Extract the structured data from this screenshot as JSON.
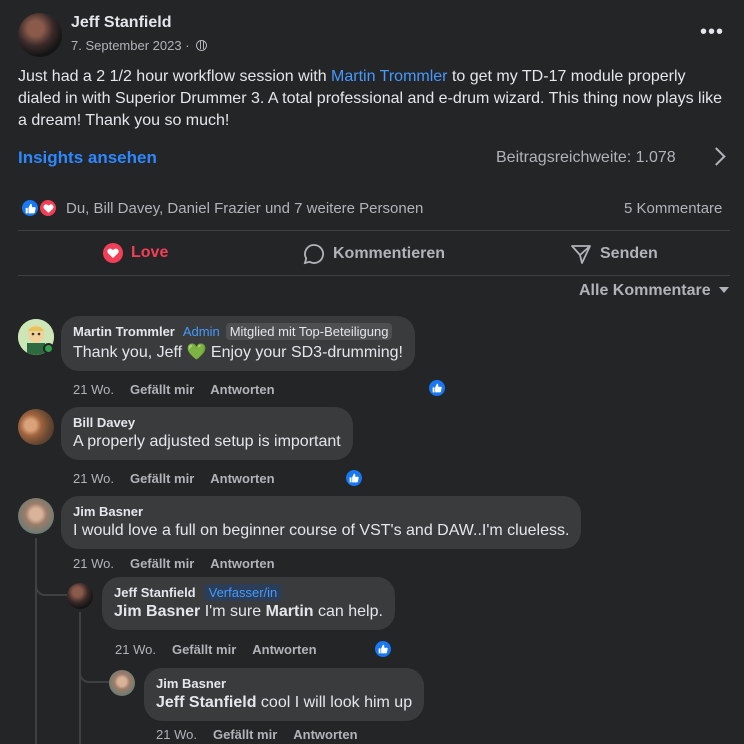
{
  "post": {
    "author": "Jeff Stanfield",
    "date": "7. September 2023 ·",
    "more_label": "•••",
    "text_before": "Just had a 2 1/2 hour workflow session with ",
    "mention": "Martin Trommler",
    "text_after": " to get my TD-17 module properly dialed in with Superior Drummer 3. A total professional and e-drum wizard. This thing now plays like a dream! Thank you so much!",
    "insights_label": "Insights ansehen",
    "reach_label": "Beitragsreichweite: 1.078",
    "reactors": "Du, Bill Davey, Daniel Frazier und 7 weitere Personen",
    "comment_count": "5 Kommentare"
  },
  "actions": {
    "love": "Love",
    "comment": "Kommentieren",
    "send": "Senden"
  },
  "sort_label": "Alle Kommentare",
  "comments": [
    {
      "name": "Martin Trommler",
      "badge1": "Admin",
      "badge2": "Mitglied mit Top-Beteiligung",
      "text": "Thank you, Jeff 💚 Enjoy your SD3-drumming!",
      "time": "21 Wo.",
      "like": "Gefällt mir",
      "reply": "Antworten"
    },
    {
      "name": "Bill Davey",
      "text": "A properly adjusted setup is important",
      "time": "21 Wo.",
      "like": "Gefällt mir",
      "reply": "Antworten"
    },
    {
      "name": "Jim Basner",
      "text": "I would love a full on beginner course of VST's and DAW..I'm clueless.",
      "time": "21 Wo.",
      "like": "Gefällt mir",
      "reply": "Antworten"
    },
    {
      "name": "Jeff Stanfield",
      "badge1": "Verfasser/in",
      "tag": "Jim Basner",
      "text_mid": " I'm sure ",
      "tag2": "Martin",
      "text_end": " can help.",
      "time": "21 Wo.",
      "like": "Gefällt mir",
      "reply": "Antworten"
    },
    {
      "name": "Jim Basner",
      "tag": "Jeff Stanfield",
      "text_end": " cool I will look him up",
      "time": "21 Wo.",
      "like": "Gefällt mir",
      "reply": "Antworten"
    }
  ],
  "colors": {
    "background": "#242526",
    "bubble": "#3a3b3c",
    "accent": "#2d88ff",
    "love": "#f33e58",
    "online": "#31a24c"
  }
}
